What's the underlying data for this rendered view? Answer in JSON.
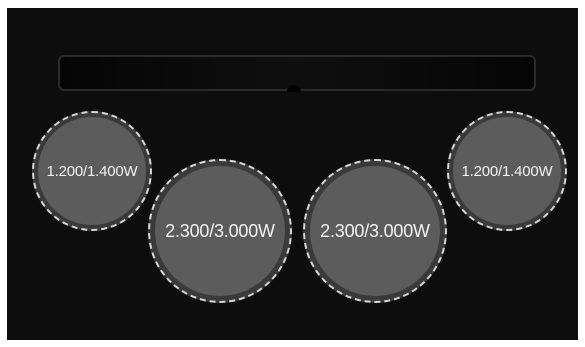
{
  "cooktop": {
    "zones": [
      {
        "label": "1.200/1.400W"
      },
      {
        "label": "2.300/3.000W"
      },
      {
        "label": "2.300/3.000W"
      },
      {
        "label": "1.200/1.400W"
      }
    ]
  },
  "colors": {
    "surface": "#0d0d0d",
    "zone_fill": "#5c5c5c",
    "zone_ring": "#d6d6d6",
    "text": "#f2f2f2"
  }
}
